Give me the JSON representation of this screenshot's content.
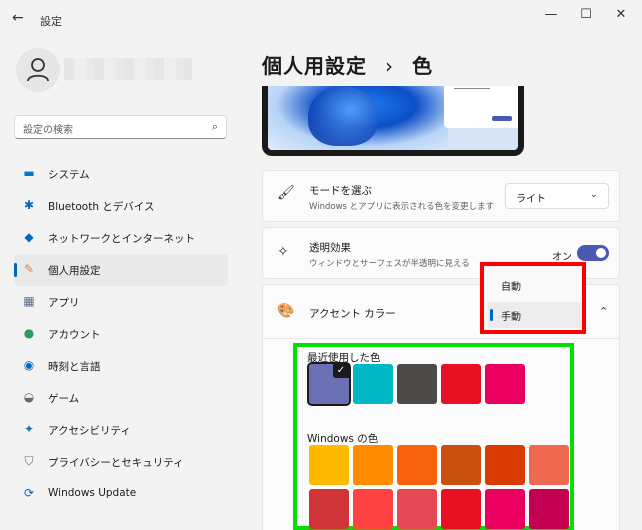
{
  "window": {
    "title": "設定"
  },
  "sidebar": {
    "search_placeholder": "設定の検索",
    "items": [
      {
        "label": "システム",
        "icon": "monitor-icon",
        "color": "#0078d4"
      },
      {
        "label": "Bluetooth とデバイス",
        "icon": "bluetooth-icon",
        "color": "#0067c0"
      },
      {
        "label": "ネットワークとインターネット",
        "icon": "wifi-icon",
        "color": "#0067c0"
      },
      {
        "label": "個人用設定",
        "icon": "brush-icon",
        "color": "#d08a4a",
        "active": true
      },
      {
        "label": "アプリ",
        "icon": "apps-icon",
        "color": "#5a6b8a"
      },
      {
        "label": "アカウント",
        "icon": "person-icon",
        "color": "#2aa05a"
      },
      {
        "label": "時刻と言語",
        "icon": "clock-globe-icon",
        "color": "#0067c0"
      },
      {
        "label": "ゲーム",
        "icon": "gamepad-icon",
        "color": "#6a6a6a"
      },
      {
        "label": "アクセシビリティ",
        "icon": "accessibility-icon",
        "color": "#1a6fc4"
      },
      {
        "label": "プライバシーとセキュリティ",
        "icon": "shield-icon",
        "color": "#6a6a6a"
      },
      {
        "label": "Windows Update",
        "icon": "update-icon",
        "color": "#0067c0"
      }
    ]
  },
  "header": {
    "breadcrumb_parent": "個人用設定",
    "separator": "›",
    "page": "色"
  },
  "mode": {
    "title": "モードを選ぶ",
    "subtitle": "Windows とアプリに表示される色を変更します",
    "value": "ライト"
  },
  "transparency": {
    "title": "透明効果",
    "subtitle": "ウィンドウとサーフェスが半透明に見える",
    "state": "オン"
  },
  "accent": {
    "title": "アクセント カラー",
    "options": [
      "自動",
      "手動"
    ],
    "selected": "手動"
  },
  "recent_colors": {
    "label": "最近使用した色",
    "colors": [
      "#6b6fb4",
      "#00b7c3",
      "#4c4a48",
      "#e81123",
      "#ea005e"
    ]
  },
  "windows_colors": {
    "label": "Windows の色",
    "rows": [
      [
        "#ffb900",
        "#ff8c00",
        "#f7630c",
        "#ca5010",
        "#da3b01",
        "#ef6950"
      ],
      [
        "#d13438",
        "#ff4343",
        "#e74856",
        "#e81123",
        "#ea005e",
        "#c30052"
      ]
    ]
  },
  "highlight_colors": {
    "popup_box": "#ff0000",
    "colors_box": "#00e000"
  }
}
